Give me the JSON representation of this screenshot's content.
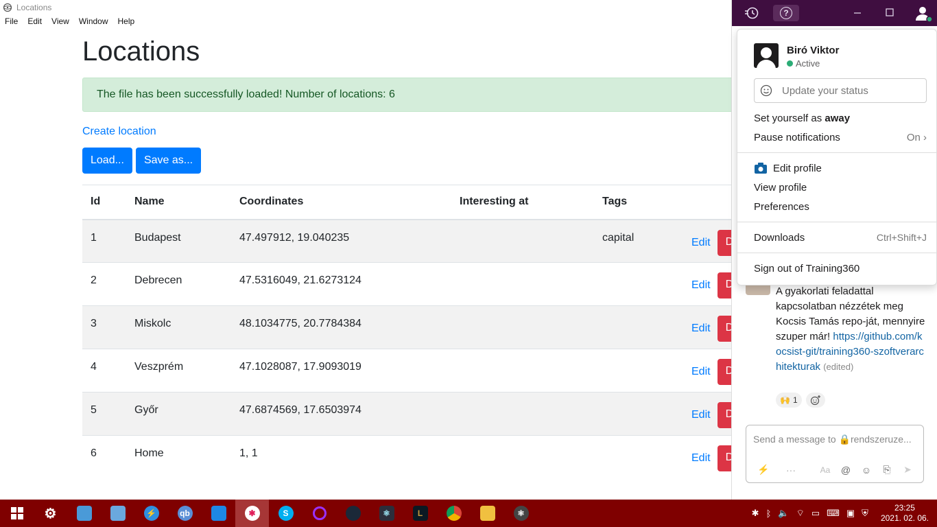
{
  "window": {
    "title": "Locations"
  },
  "menubar": [
    "File",
    "Edit",
    "View",
    "Window",
    "Help"
  ],
  "page": {
    "heading": "Locations",
    "alert": "The file has been successfully loaded! Number of locations: 6",
    "create_link": "Create location",
    "load_button": "Load...",
    "save_button": "Save as...",
    "columns": [
      "Id",
      "Name",
      "Coordinates",
      "Interesting at",
      "Tags"
    ],
    "rows": [
      {
        "id": "1",
        "name": "Budapest",
        "coords": "47.497912, 19.040235",
        "interesting": "",
        "tags": "capital",
        "edit": "Edit",
        "delete": "D"
      },
      {
        "id": "2",
        "name": "Debrecen",
        "coords": "47.5316049, 21.6273124",
        "interesting": "",
        "tags": "",
        "edit": "Edit",
        "delete": "D"
      },
      {
        "id": "3",
        "name": "Miskolc",
        "coords": "48.1034775, 20.7784384",
        "interesting": "",
        "tags": "",
        "edit": "Edit",
        "delete": "D"
      },
      {
        "id": "4",
        "name": "Veszprém",
        "coords": "47.1028087, 17.9093019",
        "interesting": "",
        "tags": "",
        "edit": "Edit",
        "delete": "D"
      },
      {
        "id": "5",
        "name": "Győr",
        "coords": "47.6874569, 17.6503974",
        "interesting": "",
        "tags": "",
        "edit": "Edit",
        "delete": "D"
      },
      {
        "id": "6",
        "name": "Home",
        "coords": "1, 1",
        "interesting": "",
        "tags": "",
        "edit": "Edit",
        "delete": "D"
      }
    ]
  },
  "slack": {
    "topbar_icons": [
      "history-icon",
      "help-icon",
      "minimize-icon",
      "maximize-icon",
      "profile-icon"
    ],
    "menu": {
      "user_name": "Biró Viktor",
      "user_status": "Active",
      "status_placeholder": "Update your status",
      "away_prefix": "Set yourself as ",
      "away_bold": "away",
      "pause_label": "Pause notifications",
      "pause_value": "On",
      "edit_profile": "Edit profile",
      "view_profile": "View profile",
      "preferences": "Preferences",
      "downloads": "Downloads",
      "downloads_shortcut": "Ctrl+Shift+J",
      "sign_out": "Sign out of Training360"
    },
    "message": {
      "text": "A gyakorlati feladattal kapcsolatban nézzétek meg Kocsis Tamás repo-ját, mennyire szuper már!",
      "link": "https://github.com/kocsist-git/training360-szoftverarchitekturak",
      "edited": "(edited)",
      "reaction_count": "1"
    },
    "composer_placeholder": "Send a message to 🔒rendszeruze..."
  },
  "taskbar": {
    "apps": [
      "start",
      "settings",
      "finder",
      "files",
      "thunder",
      "qbittorrent",
      "vscode",
      "slack",
      "skype",
      "opera",
      "steam",
      "electron",
      "league",
      "chrome",
      "explorer",
      "atom"
    ],
    "qb_label": "qb",
    "skype_label": "S",
    "clock_time": "23:25",
    "clock_date": "2021. 02. 06."
  },
  "colors": {
    "primary": "#007bff",
    "danger": "#dc3545",
    "slack_purple": "#3f0e40",
    "taskbar": "#7f0000",
    "alert_bg": "#d4edda"
  }
}
